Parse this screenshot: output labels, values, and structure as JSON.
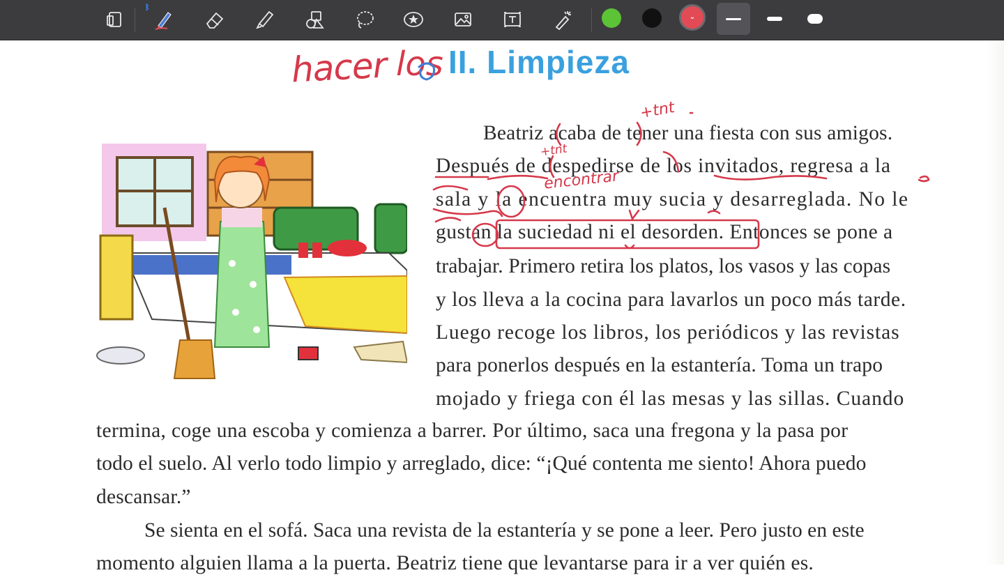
{
  "toolbar": {
    "tools": [
      {
        "name": "page-layout-icon"
      },
      {
        "name": "pen-icon",
        "selected": true
      },
      {
        "name": "eraser-icon"
      },
      {
        "name": "highlighter-icon"
      },
      {
        "name": "shapes-icon"
      },
      {
        "name": "lasso-icon"
      },
      {
        "name": "sticker-icon"
      },
      {
        "name": "image-icon"
      },
      {
        "name": "text-box-icon"
      },
      {
        "name": "laser-pointer-icon"
      }
    ],
    "bluetooth_glyph": "ᛒ",
    "colors": [
      "#5cc236",
      "#111111",
      "#e24b55"
    ],
    "active_color": "#e24b55",
    "color_chevron": "⌄",
    "stroke_widths": [
      "fine",
      "medium",
      "thick"
    ],
    "active_width": "fine"
  },
  "document": {
    "title": "II. Limpieza",
    "handwriting": {
      "hacer": "hacer",
      "los": "los",
      "tnt_top": "+tnt",
      "tnt_mid": "+tnt",
      "encontrar": "encontrar"
    },
    "paragraph1_lines": [
      "Beatriz acaba de tener una fiesta con sus amigos.",
      "Después de despedirse de los invitados, regresa a la",
      "sala y la encuentra muy sucia y desarreglada. No le",
      "gustan la suciedad ni el desorden. Entonces se pone a",
      "trabajar. Primero retira los platos, los vasos y las copas",
      "y los lleva a la cocina para lavarlos un poco más tarde.",
      "Luego recoge los libros, los periódicos y las revistas",
      "para ponerlos después en la estantería. Toma un trapo",
      "mojado y friega con él las mesas y las sillas. Cuando",
      "termina, coge una escoba y comienza a barrer. Por último, saca una fregona y la pasa por",
      "todo el suelo. Al verlo todo limpio y arreglado, dice: “¡Qué contenta me siento! Ahora puedo",
      "descansar.”"
    ],
    "paragraph2_lines": [
      "Se sienta en el sofá. Saca una revista de la estantería y se pone a leer. Pero justo en este",
      "momento alguien llama a la puerta. Beatriz tiene que levantarse para ir a ver quién es."
    ]
  }
}
